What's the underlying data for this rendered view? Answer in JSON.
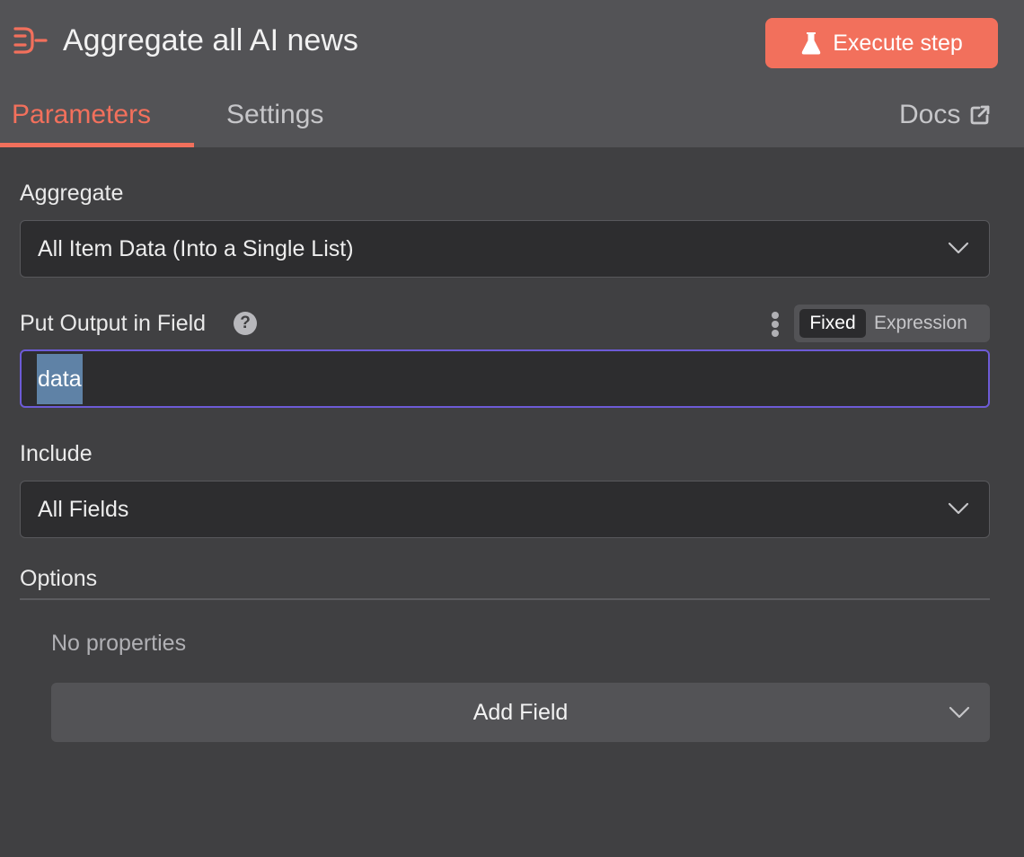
{
  "header": {
    "title": "Aggregate all AI news",
    "node_icon": "aggregate-icon",
    "execute_label": "Execute step",
    "execute_icon": "flask-icon",
    "accent_color": "#f2705c"
  },
  "tabs": [
    {
      "label": "Parameters",
      "active": true
    },
    {
      "label": "Settings",
      "active": false
    }
  ],
  "docs": {
    "label": "Docs",
    "icon": "external-link-icon"
  },
  "aggregate": {
    "label": "Aggregate",
    "value": "All Item Data (Into a Single List)"
  },
  "output_field": {
    "label": "Put Output in Field",
    "help_icon": "question-circle-icon",
    "mode_fixed": "Fixed",
    "mode_expression": "Expression",
    "selected_mode": "Fixed",
    "value": "data"
  },
  "include": {
    "label": "Include",
    "value": "All Fields"
  },
  "options": {
    "title": "Options",
    "empty_text": "No properties",
    "add_field_label": "Add Field"
  }
}
